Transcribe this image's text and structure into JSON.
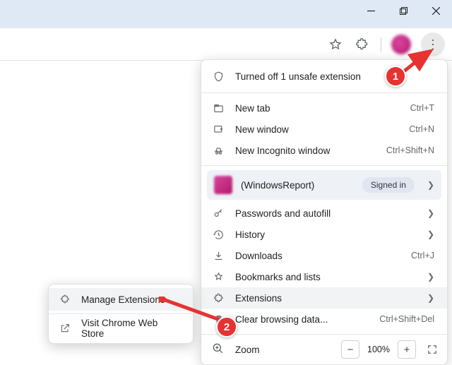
{
  "window": {
    "minimize_title": "Minimize",
    "maximize_title": "Maximize",
    "close_title": "Close"
  },
  "toolbar": {
    "star_title": "Bookmark this tab",
    "ext_title": "Extensions",
    "profile_title": "Profile",
    "menu_title": "Customize and control Google Chrome"
  },
  "menu": {
    "safety_text": "Turned off 1 unsafe extension",
    "new_tab": {
      "label": "New tab",
      "shortcut": "Ctrl+T"
    },
    "new_window": {
      "label": "New window",
      "shortcut": "Ctrl+N"
    },
    "incognito": {
      "label": "New Incognito window",
      "shortcut": "Ctrl+Shift+N"
    },
    "profile": {
      "name": "(WindowsReport)",
      "badge": "Signed in"
    },
    "passwords": {
      "label": "Passwords and autofill"
    },
    "history": {
      "label": "History"
    },
    "downloads": {
      "label": "Downloads",
      "shortcut": "Ctrl+J"
    },
    "bookmarks": {
      "label": "Bookmarks and lists"
    },
    "extensions": {
      "label": "Extensions"
    },
    "clear": {
      "label": "Clear browsing data...",
      "shortcut": "Ctrl+Shift+Del"
    },
    "zoom": {
      "label": "Zoom",
      "value": "100%",
      "minus": "−",
      "plus": "+"
    }
  },
  "submenu": {
    "manage": "Manage Extensions",
    "store": "Visit Chrome Web Store"
  },
  "annotations": {
    "b1": "1",
    "b2": "2"
  }
}
